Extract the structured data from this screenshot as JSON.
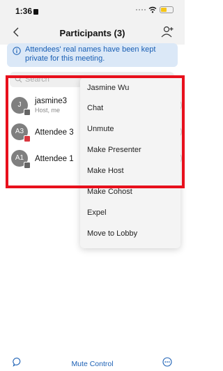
{
  "status_bar": {
    "time": "1:36"
  },
  "header": {
    "title": "Participants (3)"
  },
  "info_banner": {
    "text": "Attendees' real names have been kept private for this meeting."
  },
  "search": {
    "placeholder": "Search"
  },
  "participants": [
    {
      "initials": "J",
      "name": "jasmine3",
      "subtitle": "Host, me",
      "badge": "gray"
    },
    {
      "initials": "A3",
      "name": "Attendee 3",
      "subtitle": "",
      "badge": "red"
    },
    {
      "initials": "A1",
      "name": "Attendee 1",
      "subtitle": "",
      "badge": "gray"
    }
  ],
  "context_menu": {
    "items": [
      "Jasmine Wu",
      "Chat",
      "Unmute",
      "Make Presenter",
      "Make Host",
      "Make Cohost",
      "Expel",
      "Move to Lobby"
    ]
  },
  "bottom_bar": {
    "mute_control_label": "Mute Control"
  },
  "colors": {
    "accent": "#1a5fb4",
    "highlight": "#e8101c",
    "banner_bg": "#dbe8f7"
  }
}
